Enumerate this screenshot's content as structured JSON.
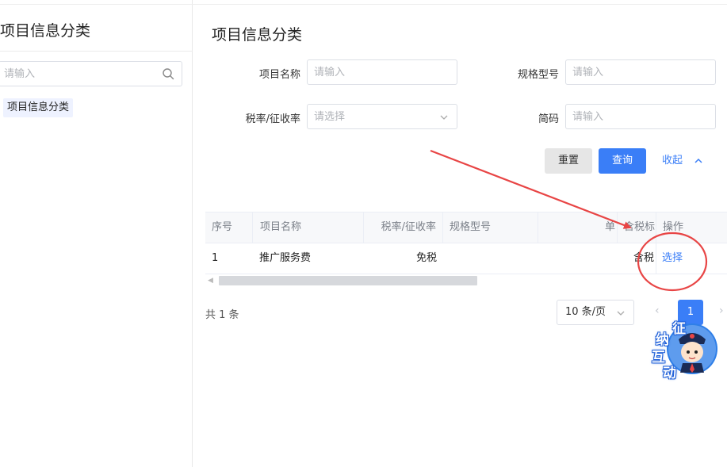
{
  "sidebar": {
    "title": "项目信息分类",
    "search_placeholder": "请输入",
    "tree_items": [
      "项目信息分类"
    ]
  },
  "main": {
    "title": "项目信息分类",
    "form": {
      "item_name_label": "项目名称",
      "item_name_placeholder": "请输入",
      "spec_label": "规格型号",
      "spec_placeholder": "请输入",
      "tax_rate_label": "税率/征收率",
      "tax_rate_placeholder": "请选择",
      "short_code_label": "简码",
      "short_code_placeholder": "请输入"
    },
    "buttons": {
      "reset": "重置",
      "query": "查询",
      "collapse": "收起"
    },
    "table": {
      "headers": [
        "序号",
        "项目名称",
        "税率/征收率",
        "规格型号",
        "单",
        "含税标",
        "操作"
      ],
      "rows": [
        {
          "index": "1",
          "name": "推广服务费",
          "tax_rate": "免税",
          "spec": "",
          "unit": "",
          "tax_included": "含税",
          "action": "选择"
        }
      ]
    },
    "pagination": {
      "total": "共 1 条",
      "page_size": "10 条/页",
      "current_page": "1"
    }
  },
  "mascot": {
    "chars": [
      "征",
      "纳",
      "互",
      "动"
    ]
  },
  "colors": {
    "primary": "#3a7ef7",
    "annotation": "#e84545"
  }
}
